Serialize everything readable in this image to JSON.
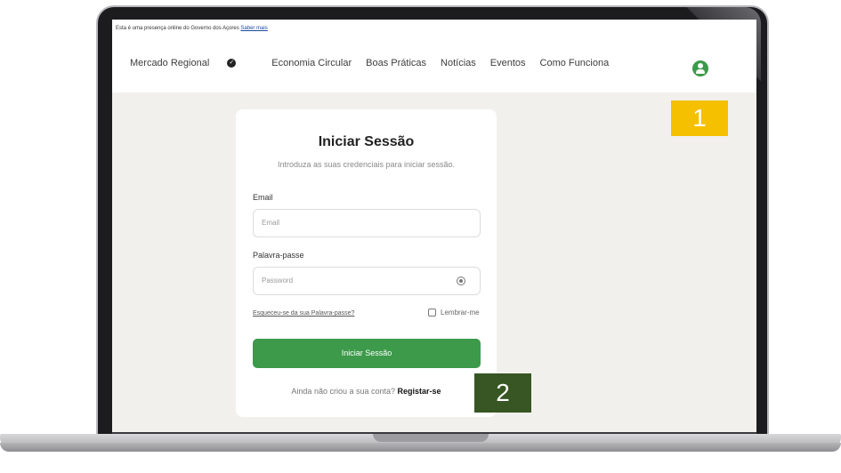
{
  "gov_bar": {
    "text": "Esta é uma presença online do Governo dos Açores",
    "link": "Saber mais"
  },
  "nav": {
    "items": [
      "Mercado Regional",
      "Economia Circular",
      "Boas Práticas",
      "Notícias",
      "Eventos",
      "Como Funciona"
    ],
    "check_glyph": "✓"
  },
  "login": {
    "title": "Iniciar Sessão",
    "subtitle": "Introduza as suas credenciais para iniciar sessão.",
    "email_label": "Email",
    "email_placeholder": "Email",
    "password_label": "Palavra-passe",
    "password_placeholder": "Password",
    "forgot": "Esqueceu-se da sua Palavra-passe?",
    "remember": "Lembrar-me",
    "submit": "Iniciar Sessão",
    "register_prompt": "Ainda não criou a sua conta?",
    "register_link": "Registar-se"
  },
  "callouts": {
    "one": "1",
    "two": "2"
  },
  "colors": {
    "accent": "#3c9a4a",
    "callout1": "#f5c000",
    "callout2": "#375623"
  },
  "icons": [
    "user-circle-icon",
    "check-badge-icon",
    "eye-icon"
  ]
}
